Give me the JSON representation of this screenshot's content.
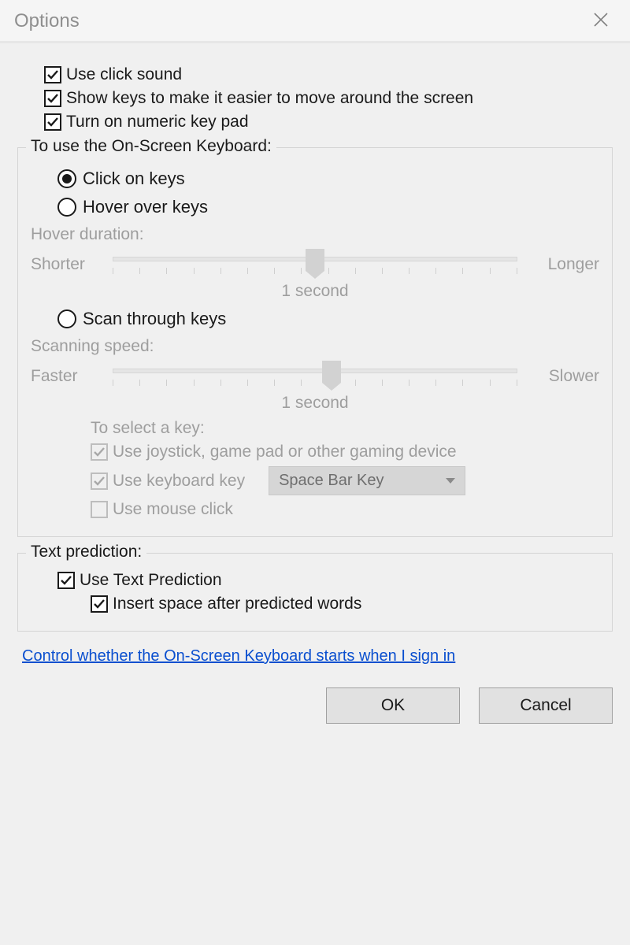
{
  "window": {
    "title": "Options"
  },
  "topChecks": {
    "clickSound": {
      "label": "Use click sound",
      "checked": true
    },
    "showKeys": {
      "label": "Show keys to make it easier to move around the screen",
      "checked": true
    },
    "numericPad": {
      "label": "Turn on numeric key pad",
      "checked": true
    }
  },
  "useOSK": {
    "legend": "To use the On-Screen Keyboard:",
    "radios": {
      "clickOnKeys": {
        "label": "Click on keys",
        "selected": true
      },
      "hoverOverKeys": {
        "label": "Hover over keys",
        "selected": false
      },
      "scanThroughKeys": {
        "label": "Scan through keys",
        "selected": false
      }
    },
    "hover": {
      "caption": "Hover duration:",
      "leftLabel": "Shorter",
      "rightLabel": "Longer",
      "value": "1 second"
    },
    "scan": {
      "caption": "Scanning speed:",
      "leftLabel": "Faster",
      "rightLabel": "Slower",
      "value": "1 second",
      "selectCaption": "To select a key:",
      "useJoystick": {
        "label": "Use joystick, game pad or other gaming device",
        "checked": true
      },
      "useKeyboard": {
        "label": "Use keyboard key",
        "checked": true,
        "keySelected": "Space Bar Key"
      },
      "useMouse": {
        "label": "Use mouse click",
        "checked": false
      }
    }
  },
  "textPrediction": {
    "legend": "Text prediction:",
    "useTP": {
      "label": "Use Text Prediction",
      "checked": true
    },
    "insertSpace": {
      "label": "Insert space after predicted words",
      "checked": true
    }
  },
  "link": "Control whether the On-Screen Keyboard starts when I sign in",
  "buttons": {
    "ok": "OK",
    "cancel": "Cancel"
  }
}
